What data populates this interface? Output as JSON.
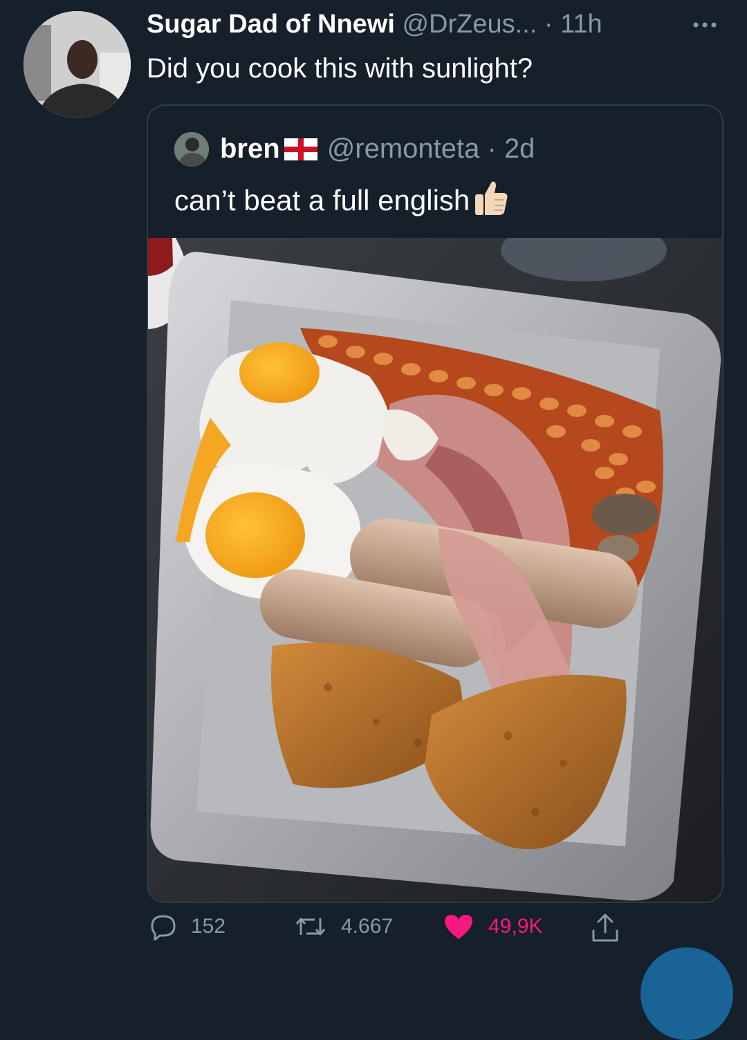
{
  "tweet": {
    "display_name": "Sugar Dad of Nnewi",
    "handle": "@DrZeus...",
    "separator": " · ",
    "time": "11h",
    "text": "Did you cook this with sunlight?",
    "more_icon": "more-horizontal-icon"
  },
  "quoted": {
    "display_name": "bren",
    "flag_icon": "england-flag-icon",
    "handle": "@remonteta",
    "separator": " · ",
    "time": "2d",
    "text": "can’t beat a full english",
    "emoji_icon": "thumbs-up-icon"
  },
  "actions": {
    "replies": "152",
    "retweets": "4.667",
    "likes": "49,9K",
    "like_color": "#f91880"
  },
  "colors": {
    "background": "#15202b",
    "muted_text": "#8b98a5",
    "accent": "#1d9bf0"
  }
}
